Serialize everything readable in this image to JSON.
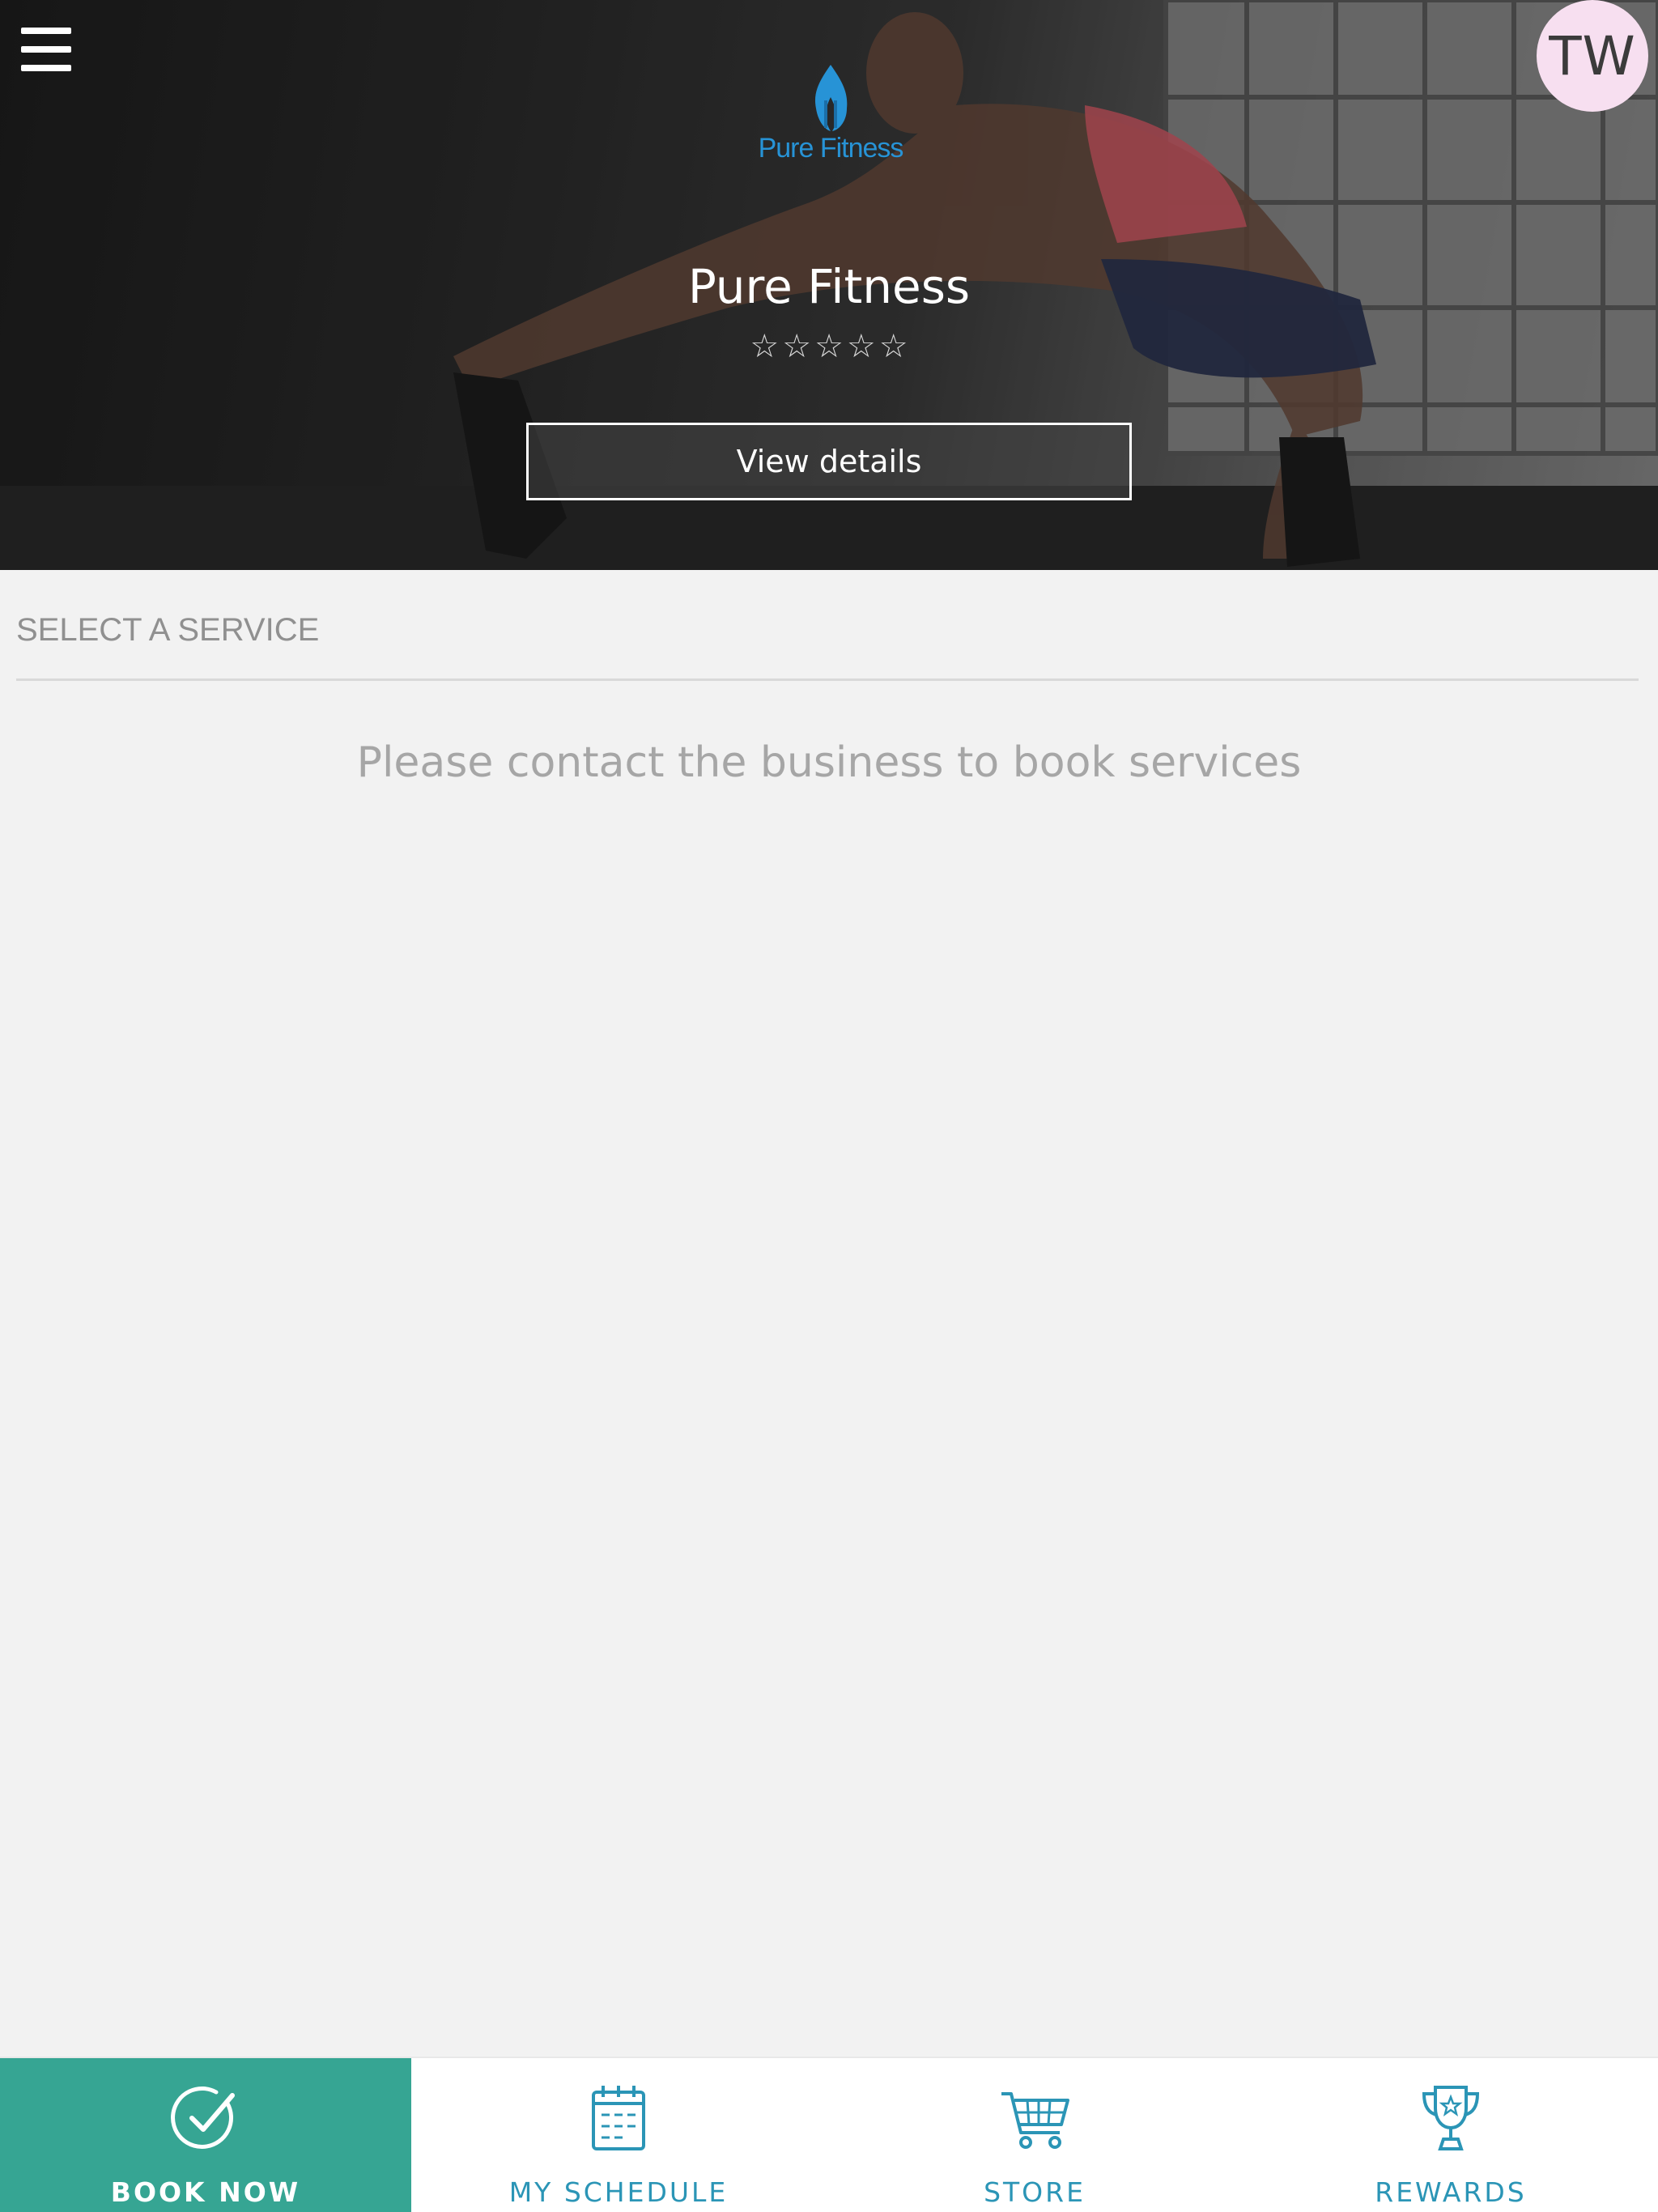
{
  "header": {
    "avatar_initials": "TW",
    "logo_text": "Pure Fitness",
    "business_name": "Pure Fitness",
    "rating_stars": [
      "☆",
      "☆",
      "☆",
      "☆",
      "☆"
    ],
    "view_details_label": "View details"
  },
  "main": {
    "section_title": "SELECT A SERVICE",
    "empty_message": "Please contact the business to book services"
  },
  "bottom_nav": {
    "items": [
      {
        "label": "BOOK NOW",
        "icon": "check-circle-icon",
        "active": true
      },
      {
        "label": "MY SCHEDULE",
        "icon": "calendar-icon",
        "active": false
      },
      {
        "label": "STORE",
        "icon": "cart-icon",
        "active": false
      },
      {
        "label": "REWARDS",
        "icon": "trophy-icon",
        "active": false
      }
    ]
  },
  "colors": {
    "accent_teal": "#36a593",
    "nav_label_blue": "#2b95b6",
    "logo_blue": "#2793d6",
    "avatar_bg": "#f7dff0"
  }
}
